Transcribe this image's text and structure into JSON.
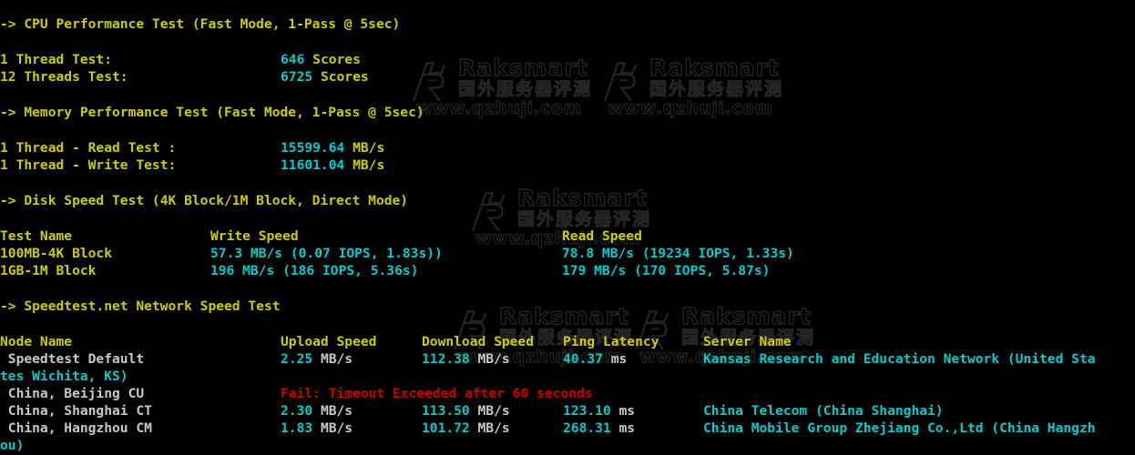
{
  "terminal": {
    "background": "#000000",
    "colors": {
      "heading": "#cdcd00",
      "label": "#cdcd00",
      "value": "#00cdcd",
      "node": "#c8c8c8",
      "error": "#cd0000"
    },
    "char_width": 9.65,
    "line_height": 19.2
  },
  "watermark": {
    "brand": "Raksmart",
    "chinese": "国外服务器评测",
    "url": "www.qzhuji.com",
    "logo_letter": "R",
    "color": "#232323"
  },
  "cpu_section": {
    "heading": "-> CPU Performance Test (Fast Mode, 1-Pass @ 5sec)",
    "rows": [
      {
        "label": "1 Thread Test:",
        "value": "646",
        "unit": "Scores"
      },
      {
        "label": "12 Threads Test:",
        "value": "6725",
        "unit": "Scores"
      }
    ]
  },
  "memory_section": {
    "heading": "-> Memory Performance Test (Fast Mode, 1-Pass @ 5sec)",
    "rows": [
      {
        "label": "1 Thread - Read Test :",
        "value": "15599.64",
        "unit": "MB/s"
      },
      {
        "label": "1 Thread - Write Test:",
        "value": "11601.04",
        "unit": "MB/s"
      }
    ]
  },
  "disk_section": {
    "heading": "-> Disk Speed Test (4K Block/1M Block, Direct Mode)",
    "headers": {
      "test_name": "Test Name",
      "write_speed": "Write Speed",
      "read_speed": "Read Speed"
    },
    "rows": [
      {
        "name": "100MB-4K Block",
        "write": "57.3 MB/s (0.07 IOPS, 1.83s))",
        "read": "78.8 MB/s (19234 IOPS, 1.33s)"
      },
      {
        "name": "1GB-1M Block",
        "write": "196 MB/s (186 IOPS, 5.36s)",
        "read": "179 MB/s (170 IOPS, 5.87s)"
      }
    ]
  },
  "speedtest_section": {
    "heading": "-> Speedtest.net Network Speed Test",
    "headers": {
      "node_name": "Node Name",
      "upload_speed": "Upload Speed",
      "download_speed": "Download Speed",
      "ping_latency": "Ping Latency",
      "server_name": "Server Name"
    },
    "rows": [
      {
        "node": " Speedtest Default",
        "upload_value": "2.25",
        "upload_unit": "MB/s",
        "download_value": "112.38",
        "download_unit": "MB/s",
        "ping_value": "40.37",
        "ping_unit": "ms",
        "server": "Kansas Research and Education Network (United Sta",
        "server_wrap": "tes Wichita, KS)",
        "failed": false
      },
      {
        "node": " China, Beijing CU",
        "error": "Fail: Timeout Exceeded after 60 seconds",
        "failed": true
      },
      {
        "node": " China, Shanghai CT",
        "upload_value": "2.30",
        "upload_unit": "MB/s",
        "download_value": "113.50",
        "download_unit": "MB/s",
        "ping_value": "123.10",
        "ping_unit": "ms",
        "server": "China Telecom (China Shanghai)",
        "server_wrap": "",
        "failed": false
      },
      {
        "node": " China, Hangzhou CM",
        "upload_value": "1.83",
        "upload_unit": "MB/s",
        "download_value": "101.72",
        "download_unit": "MB/s",
        "ping_value": "268.31",
        "ping_unit": "ms",
        "server": "China Mobile Group Zhejiang Co.,Ltd (China Hangzh",
        "server_wrap": "ou)",
        "failed": false
      }
    ]
  }
}
